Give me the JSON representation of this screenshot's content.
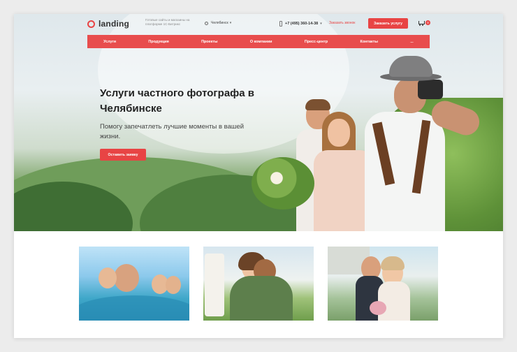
{
  "header": {
    "logo_text": "landing",
    "tagline": "Готовые сайты и магазины на платформе 1С-Битрикс",
    "city": "Челябинск",
    "phone": "+7 (495) 360-14-38",
    "callback_link": "Заказать звонок",
    "order_button": "Заказать услугу",
    "cart_count": "0"
  },
  "nav": {
    "items": [
      "Услуги",
      "Продукция",
      "Проекты",
      "О компании",
      "Пресс-центр",
      "Контакты",
      "..."
    ]
  },
  "hero": {
    "title": "Услуги частного фотографа в Челябинске",
    "subtitle": "Помогу запечатлеть лучшие моменты в вашей жизни.",
    "button": "Оставить заявку"
  },
  "gallery": {
    "items": [
      "family-swimming-photo",
      "couple-hugging-photo",
      "wedding-kiss-photo"
    ]
  },
  "colors": {
    "accent": "#e84444",
    "nav_bg": "#e84d4d",
    "text_dark": "#222222"
  }
}
